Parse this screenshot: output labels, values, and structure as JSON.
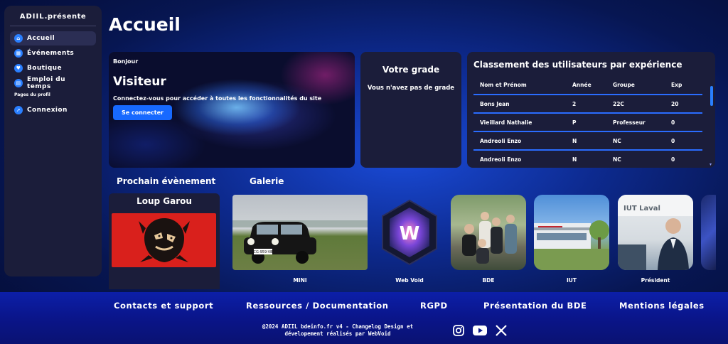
{
  "brand": {
    "logo": "ADIIL",
    "suffix": ".présente"
  },
  "sidebar": {
    "items": [
      {
        "label": "Accueil",
        "icon": "home-icon"
      },
      {
        "label": "Événements",
        "icon": "calendar-icon"
      },
      {
        "label": "Boutique",
        "icon": "shop-icon"
      },
      {
        "label": "Emploi du temps",
        "icon": "schedule-icon"
      }
    ],
    "section_label": "Pages du profil",
    "profile_items": [
      {
        "label": "Connexion",
        "icon": "rocket-icon"
      }
    ]
  },
  "page": {
    "title": "Accueil"
  },
  "welcome": {
    "greeting": "Bonjour",
    "name": "Visiteur",
    "message": "Connectez-vous pour accéder à toutes les fonctionnalités du site",
    "button": "Se connecter"
  },
  "grade": {
    "title": "Votre grade",
    "status": "Vous n'avez pas de grade"
  },
  "ranking": {
    "title": "Classement des utilisateurs par expérience",
    "columns": [
      "Nom et Prénom",
      "Année",
      "Groupe",
      "Exp"
    ],
    "rows": [
      [
        "Bons Jean",
        "2",
        "22C",
        "20"
      ],
      [
        "Vieillard Nathalie",
        "P",
        "Professeur",
        "0"
      ],
      [
        "Andreoli Enzo",
        "N",
        "NC",
        "0"
      ],
      [
        "Andreoli Enzo",
        "N",
        "NC",
        "0"
      ]
    ]
  },
  "next_event": {
    "section_title": "Prochain évènement",
    "title": "Loup Garou"
  },
  "gallery": {
    "section_title": "Galerie",
    "items": [
      {
        "label": "MINI",
        "plate": "CG-959-VB"
      },
      {
        "label": "Web Void",
        "logo_letter": "W"
      },
      {
        "label": "BDE"
      },
      {
        "label": "IUT"
      },
      {
        "label": "Président",
        "sign": "IUT Laval"
      }
    ]
  },
  "footer": {
    "links": [
      "Contacts et support",
      "Ressources / Documentation",
      "RGPD",
      "Présentation du BDE",
      "Mentions légales"
    ],
    "copyright_line1": "@2024 ADIIL bdeinfo.fr v4 - Changelog Design et",
    "copyright_line2": "dévelopement réalisés par WebVoid",
    "socials": [
      "instagram-icon",
      "youtube-icon",
      "x-icon"
    ]
  },
  "colors": {
    "accent": "#1769ff",
    "card": "#1b1d3a",
    "event_red": "#d9201c"
  }
}
